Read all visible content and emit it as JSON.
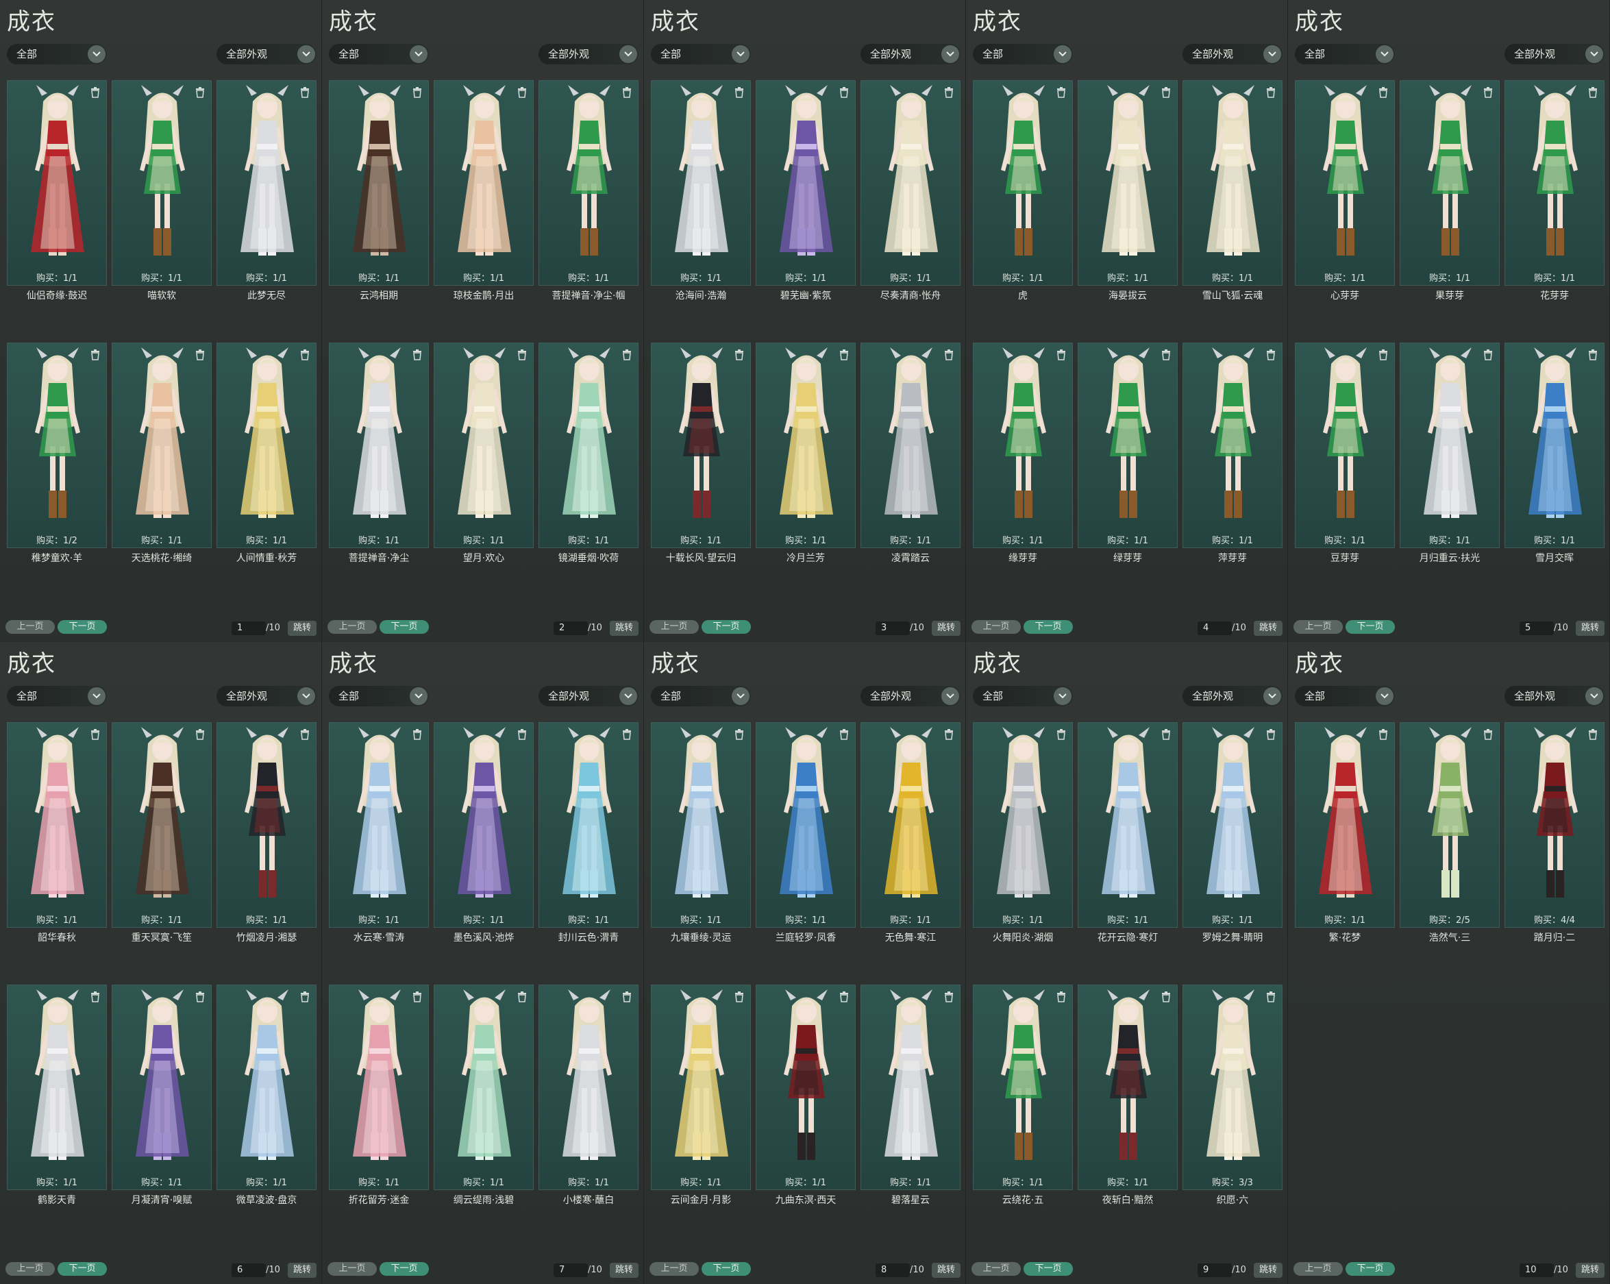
{
  "colors": {
    "accent_next": "#3f8f76",
    "card_bg": "#2f5650",
    "panel_bg": "#323735"
  },
  "icons": {
    "dropdown": "chevron-down-icon",
    "card_action": "trash-icon"
  },
  "panels": [
    {
      "title": "成衣",
      "filter1": "全部",
      "filter2": "全部外观",
      "prev": "上一页",
      "next": "下一页",
      "page": "1",
      "total": "/10",
      "jump": "跳转",
      "items": [
        {
          "name": "仙侣奇缘·鼓迟",
          "buy": "购买：1/1",
          "outfit": "red"
        },
        {
          "name": "喵软软",
          "buy": "购买：1/1",
          "outfit": "green"
        },
        {
          "name": "此梦无尽",
          "buy": "购买：1/1",
          "outfit": "white"
        },
        {
          "name": "稚梦童欢·羊",
          "buy": "购买：1/2",
          "outfit": "green"
        },
        {
          "name": "天选桃花·缃绮",
          "buy": "购买：1/1",
          "outfit": "peach"
        },
        {
          "name": "人间情重·秋芳",
          "buy": "购买：1/1",
          "outfit": "yellow"
        }
      ]
    },
    {
      "title": "成衣",
      "filter1": "全部",
      "filter2": "全部外观",
      "prev": "上一页",
      "next": "下一页",
      "page": "2",
      "total": "/10",
      "jump": "跳转",
      "items": [
        {
          "name": "云鸿相期",
          "buy": "购买：1/1",
          "outfit": "brown"
        },
        {
          "name": "琼枝金鹊·月出",
          "buy": "购买：1/1",
          "outfit": "peach"
        },
        {
          "name": "菩提禅音·净尘·帼",
          "buy": "购买：1/1",
          "outfit": "green"
        },
        {
          "name": "菩提禅音·净尘",
          "buy": "购买：1/1",
          "outfit": "white"
        },
        {
          "name": "望月·欢心",
          "buy": "购买：1/1",
          "outfit": "cream"
        },
        {
          "name": "镜湖垂烟·吹荷",
          "buy": "购买：1/1",
          "outfit": "mint"
        }
      ]
    },
    {
      "title": "成衣",
      "filter1": "全部",
      "filter2": "全部外观",
      "prev": "上一页",
      "next": "下一页",
      "page": "3",
      "total": "/10",
      "jump": "跳转",
      "items": [
        {
          "name": "沧海间·浩瀚",
          "buy": "购买：1/1",
          "outfit": "white"
        },
        {
          "name": "碧芜幽·紫氛",
          "buy": "购买：1/1",
          "outfit": "purple"
        },
        {
          "name": "尽奏清商·怅舟",
          "buy": "购买：1/1",
          "outfit": "cream"
        },
        {
          "name": "十载长风·望云归",
          "buy": "购买：1/1",
          "outfit": "black"
        },
        {
          "name": "冷月兰芳",
          "buy": "购买：1/1",
          "outfit": "yellow"
        },
        {
          "name": "凌霄踏云",
          "buy": "购买：1/1",
          "outfit": "grey"
        }
      ]
    },
    {
      "title": "成衣",
      "filter1": "全部",
      "filter2": "全部外观",
      "prev": "上一页",
      "next": "下一页",
      "page": "4",
      "total": "/10",
      "jump": "跳转",
      "items": [
        {
          "name": "虎",
          "buy": "购买：1/1",
          "outfit": "green"
        },
        {
          "name": "海晏拔云",
          "buy": "购买：1/1",
          "outfit": "cream"
        },
        {
          "name": "雪山飞狐·云魂",
          "buy": "购买：1/1",
          "outfit": "cream"
        },
        {
          "name": "缘芽芽",
          "buy": "购买：1/1",
          "outfit": "green"
        },
        {
          "name": "绿芽芽",
          "buy": "购买：1/1",
          "outfit": "green"
        },
        {
          "name": "萍芽芽",
          "buy": "购买：1/1",
          "outfit": "green"
        }
      ]
    },
    {
      "title": "成衣",
      "filter1": "全部",
      "filter2": "全部外观",
      "prev": "上一页",
      "next": "下一页",
      "page": "5",
      "total": "/10",
      "jump": "跳转",
      "items": [
        {
          "name": "心芽芽",
          "buy": "购买：1/1",
          "outfit": "green"
        },
        {
          "name": "果芽芽",
          "buy": "购买：1/1",
          "outfit": "green"
        },
        {
          "name": "花芽芽",
          "buy": "购买：1/1",
          "outfit": "green"
        },
        {
          "name": "豆芽芽",
          "buy": "购买：1/1",
          "outfit": "green"
        },
        {
          "name": "月归重云·扶光",
          "buy": "购买：1/1",
          "outfit": "white"
        },
        {
          "name": "雪月交晖",
          "buy": "购买：1/1",
          "outfit": "blue"
        }
      ]
    },
    {
      "title": "成衣",
      "filter1": "全部",
      "filter2": "全部外观",
      "prev": "上一页",
      "next": "下一页",
      "page": "6",
      "total": "/10",
      "jump": "跳转",
      "items": [
        {
          "name": "韶华春秋",
          "buy": "购买：1/1",
          "outfit": "pink"
        },
        {
          "name": "重天冥寞·飞笙",
          "buy": "购买：1/1",
          "outfit": "brown"
        },
        {
          "name": "竹烟凌月·湘瑟",
          "buy": "购买：1/1",
          "outfit": "black"
        },
        {
          "name": "鹤影天青",
          "buy": "购买：1/1",
          "outfit": "white"
        },
        {
          "name": "月凝清宵·嗅赋",
          "buy": "购买：1/1",
          "outfit": "purple"
        },
        {
          "name": "微草凌波·盘京",
          "buy": "购买：1/1",
          "outfit": "lightblue"
        }
      ]
    },
    {
      "title": "成衣",
      "filter1": "全部",
      "filter2": "全部外观",
      "prev": "上一页",
      "next": "下一页",
      "page": "7",
      "total": "/10",
      "jump": "跳转",
      "items": [
        {
          "name": "水云寒·雪涛",
          "buy": "购买：1/1",
          "outfit": "lightblue"
        },
        {
          "name": "墨色溪风·池烨",
          "buy": "购买：1/1",
          "outfit": "purple"
        },
        {
          "name": "封川云色·渭青",
          "buy": "购买：1/1",
          "outfit": "cyan"
        },
        {
          "name": "折花留芳·迷金",
          "buy": "购买：1/1",
          "outfit": "pink"
        },
        {
          "name": "绸云缇雨·浅碧",
          "buy": "购买：1/1",
          "outfit": "mint"
        },
        {
          "name": "小楼寒·蘸白",
          "buy": "购买：1/1",
          "outfit": "white"
        }
      ]
    },
    {
      "title": "成衣",
      "filter1": "全部",
      "filter2": "全部外观",
      "prev": "上一页",
      "next": "下一页",
      "page": "8",
      "total": "/10",
      "jump": "跳转",
      "items": [
        {
          "name": "九壤垂绫·灵运",
          "buy": "购买：1/1",
          "outfit": "lightblue"
        },
        {
          "name": "兰庭轻罗·凤香",
          "buy": "购买：1/1",
          "outfit": "blue"
        },
        {
          "name": "无色舞·寒江",
          "buy": "购买：1/1",
          "outfit": "gold"
        },
        {
          "name": "云间金月·月影",
          "buy": "购买：1/1",
          "outfit": "yellow"
        },
        {
          "name": "九曲东溟·西天",
          "buy": "购买：1/1",
          "outfit": "darkred"
        },
        {
          "name": "碧落星云",
          "buy": "购买：1/1",
          "outfit": "white"
        }
      ]
    },
    {
      "title": "成衣",
      "filter1": "全部",
      "filter2": "全部外观",
      "prev": "上一页",
      "next": "下一页",
      "page": "9",
      "total": "/10",
      "jump": "跳转",
      "items": [
        {
          "name": "火舞阳炎·湖烟",
          "buy": "购买：1/1",
          "outfit": "grey"
        },
        {
          "name": "花开云隐·寒灯",
          "buy": "购买：1/1",
          "outfit": "lightblue"
        },
        {
          "name": "罗姆之舞·睛明",
          "buy": "购买：1/1",
          "outfit": "lightblue"
        },
        {
          "name": "云绕花·五",
          "buy": "购买：1/1",
          "outfit": "green"
        },
        {
          "name": "夜斩白·黯然",
          "buy": "购买：1/1",
          "outfit": "black"
        },
        {
          "name": "织愿·六",
          "buy": "购买：3/3",
          "outfit": "cream"
        }
      ]
    },
    {
      "title": "成衣",
      "filter1": "全部",
      "filter2": "全部外观",
      "prev": "上一页",
      "next": "下一页",
      "page": "10",
      "total": "/10",
      "jump": "跳转",
      "items": [
        {
          "name": "繁·花梦",
          "buy": "购买：1/1",
          "outfit": "red"
        },
        {
          "name": "浩然气·三",
          "buy": "购买：2/5",
          "outfit": "olive"
        },
        {
          "name": "踏月归·二",
          "buy": "购买：4/4",
          "outfit": "darkred"
        }
      ]
    }
  ]
}
